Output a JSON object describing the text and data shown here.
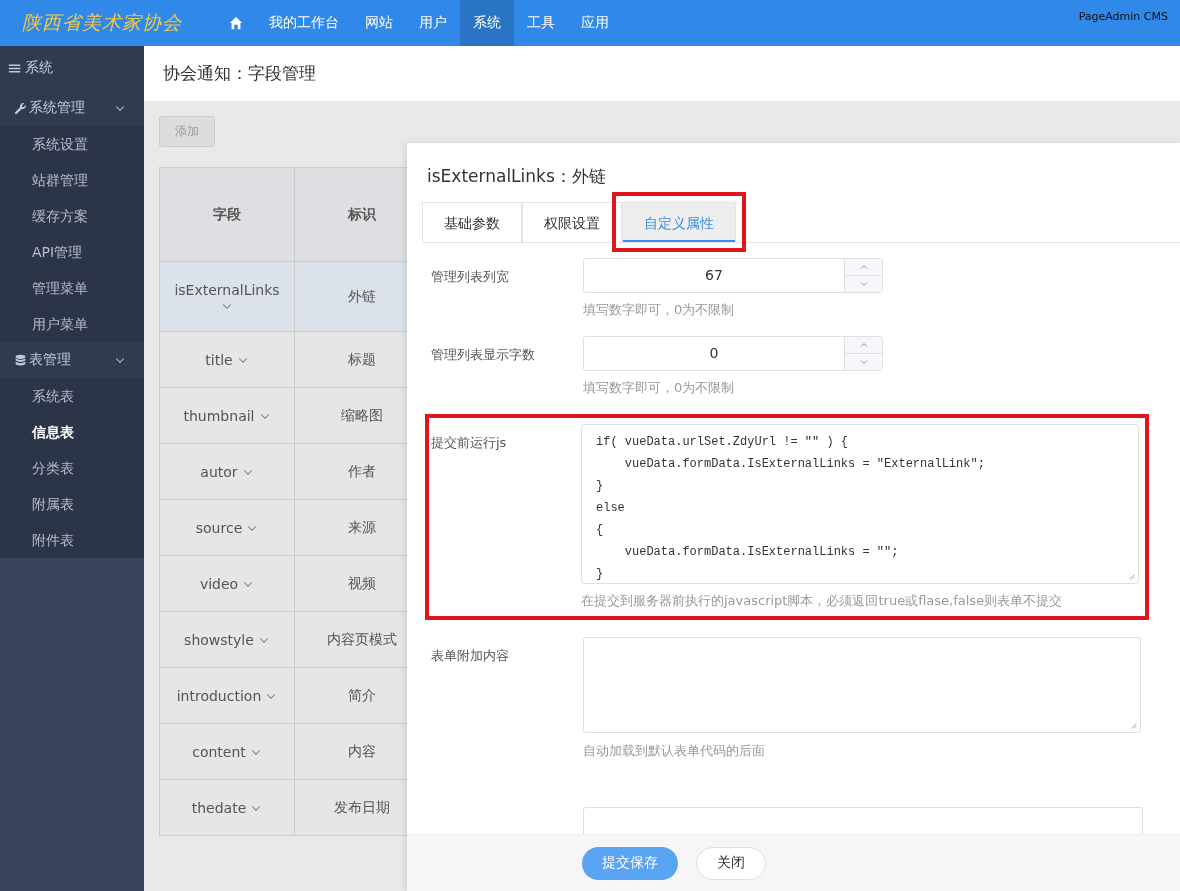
{
  "logo": {
    "text": "陕西省美术家协会"
  },
  "top_nav": [
    {
      "kind": "home",
      "selected": false
    },
    {
      "kind": "text",
      "label": "我的工作台",
      "selected": false
    },
    {
      "kind": "text",
      "label": "网站",
      "selected": false
    },
    {
      "kind": "text",
      "label": "用户",
      "selected": false
    },
    {
      "kind": "text",
      "label": "系统",
      "selected": true
    },
    {
      "kind": "text",
      "label": "工具",
      "selected": false
    },
    {
      "kind": "text",
      "label": "应用",
      "selected": false
    }
  ],
  "brand": "PageAdmin CMS",
  "sidebar": {
    "title": "系统",
    "groups": [
      {
        "label": "系统管理",
        "expanded": true,
        "items": [
          {
            "label": "系统设置",
            "selected": false
          },
          {
            "label": "站群管理",
            "selected": false
          },
          {
            "label": "缓存方案",
            "selected": false
          },
          {
            "label": "API管理",
            "selected": false
          },
          {
            "label": "管理菜单",
            "selected": false
          },
          {
            "label": "用户菜单",
            "selected": false
          }
        ]
      },
      {
        "label": "表管理",
        "expanded": true,
        "items": [
          {
            "label": "系统表",
            "selected": false
          },
          {
            "label": "信息表",
            "selected": true
          },
          {
            "label": "分类表",
            "selected": false
          },
          {
            "label": "附属表",
            "selected": false
          },
          {
            "label": "附件表",
            "selected": false
          }
        ]
      }
    ]
  },
  "page_title": "协会通知：字段管理",
  "add_button": {
    "label": "添加",
    "disabled": true
  },
  "table": {
    "columns": [
      "字段",
      "标识"
    ],
    "rows": [
      {
        "cells": [
          "isExternalLinks",
          "外链"
        ],
        "selected": true
      },
      {
        "cells": [
          "title",
          "标题"
        ],
        "selected": false
      },
      {
        "cells": [
          "thumbnail",
          "缩略图"
        ],
        "selected": false
      },
      {
        "cells": [
          "autor",
          "作者"
        ],
        "selected": false
      },
      {
        "cells": [
          "source",
          "来源"
        ],
        "selected": false
      },
      {
        "cells": [
          "video",
          "视频"
        ],
        "selected": false
      },
      {
        "cells": [
          "showstyle",
          "内容页模式"
        ],
        "selected": false
      },
      {
        "cells": [
          "introduction",
          "简介"
        ],
        "selected": false
      },
      {
        "cells": [
          "content",
          "内容"
        ],
        "selected": false
      },
      {
        "cells": [
          "thedate",
          "发布日期"
        ],
        "selected": false
      }
    ]
  },
  "dialog": {
    "title": "isExternalLinks：外链",
    "tabs": [
      {
        "label": "基础参数",
        "selected": false,
        "highlighted": false
      },
      {
        "label": "权限设置",
        "selected": false,
        "highlighted": false
      },
      {
        "label": "自定义属性",
        "selected": true,
        "highlighted": true
      }
    ],
    "fields": [
      {
        "kind": "number",
        "label": "管理列表列宽",
        "value": "67",
        "hint": "填写数字即可，0为不限制",
        "highlighted": false
      },
      {
        "kind": "number",
        "label": "管理列表显示字数",
        "value": "0",
        "hint": "填写数字即可，0为不限制",
        "highlighted": false
      },
      {
        "kind": "code",
        "label": "提交前运行js",
        "value": "if( vueData.urlSet.ZdyUrl != \"\" ) {\n    vueData.formData.IsExternalLinks = \"ExternalLink\";\n}\nelse\n{\n    vueData.formData.IsExternalLinks = \"\";\n}",
        "hint": "在提交到服务器前执行的javascript脚本，必须返回true或flase,false则表单不提交",
        "highlighted": true
      },
      {
        "kind": "textarea",
        "label": "表单附加内容",
        "hint": "自动加载到默认表单代码的后面",
        "highlighted": false
      },
      {
        "kind": "text",
        "highlighted": false
      }
    ],
    "buttons": [
      {
        "kind": "primary",
        "label": "提交保存"
      },
      {
        "kind": "default",
        "label": "关闭"
      }
    ]
  }
}
